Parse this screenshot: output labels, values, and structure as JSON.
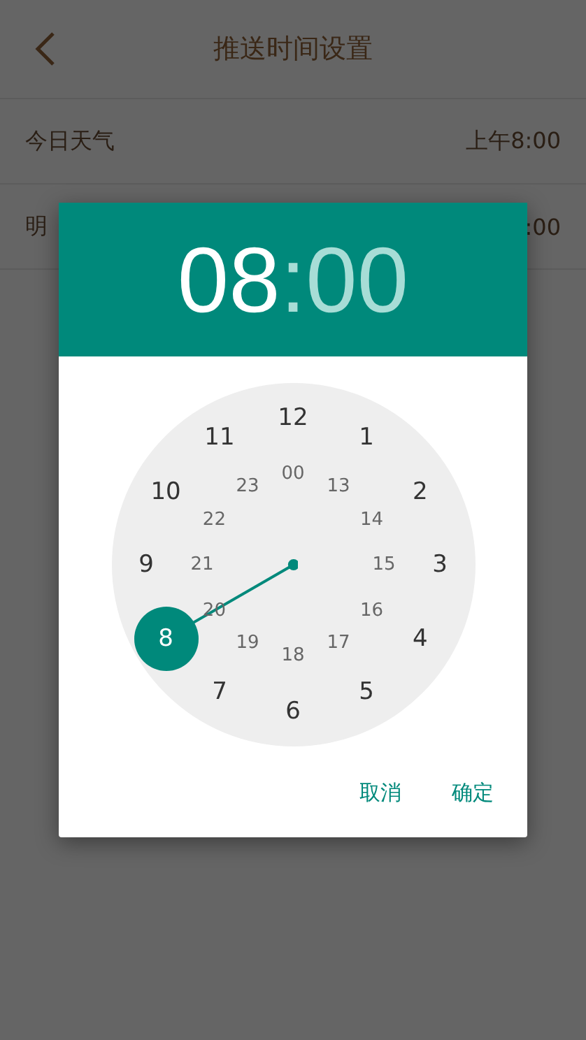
{
  "header": {
    "title": "推送时间设置"
  },
  "rows": [
    {
      "label": "今日天气",
      "value": "上午8:00"
    },
    {
      "label": "明",
      "value": ":00"
    }
  ],
  "dialog": {
    "time": [
      {
        "text": "08",
        "selected": true
      },
      {
        "text": ":",
        "selected": false
      },
      {
        "text": "00",
        "selected": false
      }
    ],
    "outer": [
      {
        "text": "12",
        "selected": false
      },
      {
        "text": "1",
        "selected": false
      },
      {
        "text": "2",
        "selected": false
      },
      {
        "text": "3",
        "selected": false
      },
      {
        "text": "4",
        "selected": false
      },
      {
        "text": "5",
        "selected": false
      },
      {
        "text": "6",
        "selected": false
      },
      {
        "text": "7",
        "selected": false
      },
      {
        "text": "8",
        "selected": true
      },
      {
        "text": "9",
        "selected": false
      },
      {
        "text": "10",
        "selected": false
      },
      {
        "text": "11",
        "selected": false
      }
    ],
    "inner": [
      {
        "text": "00",
        "selected": false
      },
      {
        "text": "13",
        "selected": false
      },
      {
        "text": "14",
        "selected": false
      },
      {
        "text": "15",
        "selected": false
      },
      {
        "text": "16",
        "selected": false
      },
      {
        "text": "17",
        "selected": false
      },
      {
        "text": "18",
        "selected": false
      },
      {
        "text": "19",
        "selected": false
      },
      {
        "text": "20",
        "selected": false
      },
      {
        "text": "21",
        "selected": false
      },
      {
        "text": "22",
        "selected": false
      },
      {
        "text": "23",
        "selected": false
      }
    ],
    "buttons": [
      "取消",
      "确定"
    ]
  }
}
